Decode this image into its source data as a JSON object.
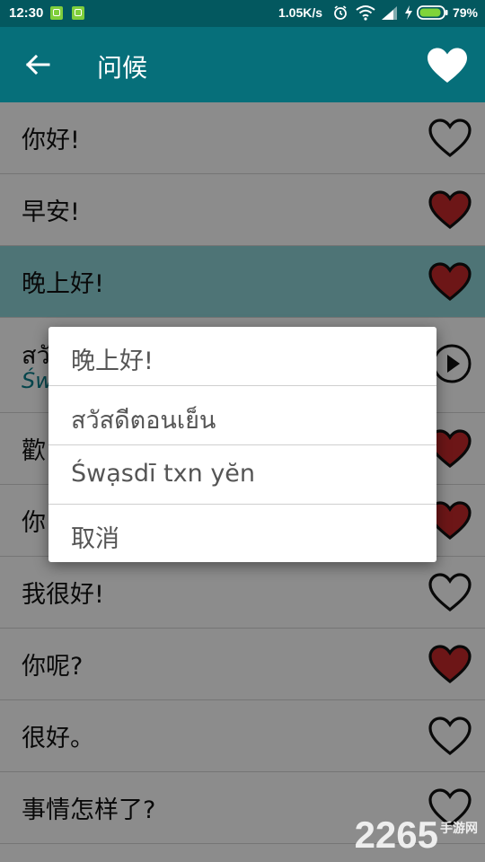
{
  "status_bar": {
    "time": "12:30",
    "speed": "1.05K/s",
    "battery": "79%",
    "icons": [
      "notification-icon",
      "notification-icon",
      "alarm-icon",
      "wifi-icon",
      "signal-icon",
      "charging-icon",
      "battery-icon"
    ]
  },
  "app_bar": {
    "title": "问候",
    "back_icon": "arrow-back-icon",
    "favorite_icon": "heart-icon"
  },
  "colors": {
    "app_bar": "#066f7a",
    "status_bar": "#03585f",
    "selected_row": "#8fd3d8",
    "heart_filled": "#c6282b",
    "subtitle": "#0b7f8a"
  },
  "list": {
    "rows": [
      {
        "text": "你好!",
        "favorite": false
      },
      {
        "text": "早安!",
        "favorite": true
      },
      {
        "text": "晚上好!",
        "favorite": true,
        "selected": true
      },
      {
        "text": "สวั",
        "sub": "Św",
        "play": true
      },
      {
        "text": "歡",
        "favorite": true
      },
      {
        "text": "你",
        "favorite": true
      },
      {
        "text": "我很好!",
        "favorite": false
      },
      {
        "text": "你呢?",
        "favorite": true
      },
      {
        "text": "很好。",
        "favorite": false
      },
      {
        "text": "事情怎样了?",
        "favorite": false
      }
    ]
  },
  "dialog": {
    "items": [
      "晚上好!",
      "สวัสดีตอนเย็น",
      "Śwạsdī txn yĕn",
      "取消"
    ]
  },
  "watermark": {
    "number": "2265",
    "suffix": "手游网"
  }
}
